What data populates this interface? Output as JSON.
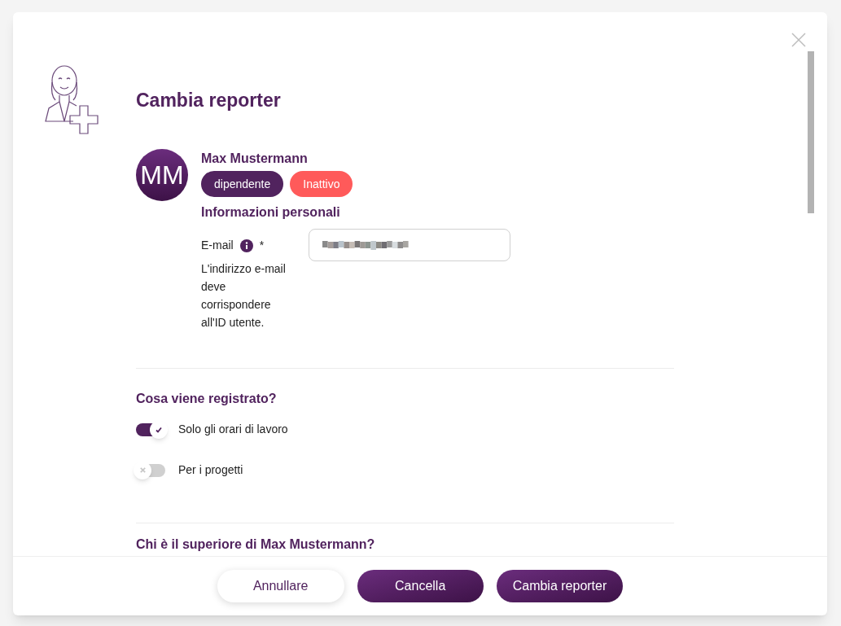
{
  "dialog": {
    "title": "Cambia reporter"
  },
  "user": {
    "initials": "MM",
    "name": "Max Mustermann",
    "badges": [
      {
        "label": "dipendente",
        "color": "#51235e"
      },
      {
        "label": "Inattivo",
        "color": "#ff5a5a"
      }
    ]
  },
  "personal": {
    "heading": "Informazioni personali",
    "email_label": "E-mail",
    "required_mark": "*",
    "email_hint": "L'indirizzo e-mail deve corrispondere all'ID utente.",
    "email_redacted": true
  },
  "tracking": {
    "heading": "Cosa viene registrato?",
    "options": [
      {
        "label": "Solo gli orari di lavoro",
        "on": true
      },
      {
        "label": "Per i progetti",
        "on": false
      }
    ]
  },
  "supervisor": {
    "heading": "Chi è il superiore di Max Mustermann?"
  },
  "buttons": [
    {
      "label": "Annullare",
      "kind": "secondary"
    },
    {
      "label": "Cancella",
      "kind": "primary"
    },
    {
      "label": "Cambia reporter",
      "kind": "primary"
    }
  ]
}
